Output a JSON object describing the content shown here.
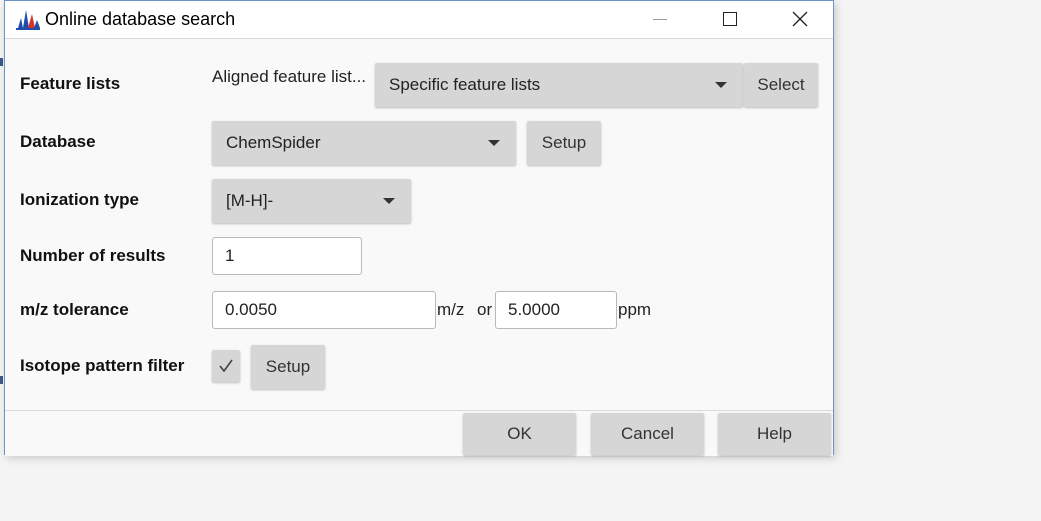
{
  "window": {
    "title": "Online database search",
    "controls": {
      "minimize": "minimize",
      "maximize": "maximize",
      "close": "close"
    }
  },
  "form": {
    "feature_lists": {
      "label": "Feature lists",
      "aligned_text": "Aligned feature list...",
      "selected": "Specific feature lists",
      "select_button": "Select"
    },
    "database": {
      "label": "Database",
      "selected": "ChemSpider",
      "setup_button": "Setup"
    },
    "ionization": {
      "label": "Ionization type",
      "selected": "[M-H]-"
    },
    "num_results": {
      "label": "Number of results",
      "value": "1"
    },
    "mz_tolerance": {
      "label": "m/z tolerance",
      "mz_value": "0.0050",
      "mz_unit": "m/z",
      "or_text": "or",
      "ppm_value": "5.0000",
      "ppm_unit": "ppm"
    },
    "isotope": {
      "label": "Isotope pattern filter",
      "checked": true,
      "setup_button": "Setup"
    }
  },
  "footer": {
    "ok": "OK",
    "cancel": "Cancel",
    "help": "Help"
  },
  "colors": {
    "window_border": "#6e93c9",
    "button_bg": "#d6d6d6",
    "icon_blue": "#1f4fa8",
    "icon_red": "#d6332a"
  }
}
